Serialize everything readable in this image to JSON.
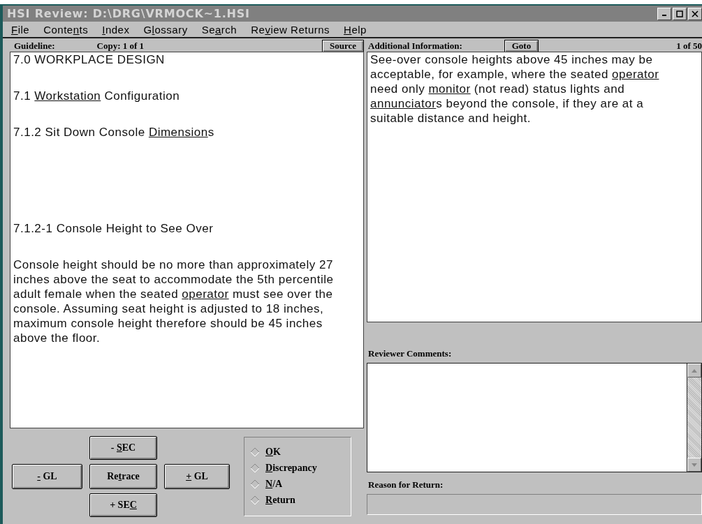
{
  "window": {
    "title": "HSI Review: D:\\DRG\\VRMOCK~1.HSI"
  },
  "menu": [
    {
      "key": "F",
      "post": "ile"
    },
    {
      "pre": "Conte",
      "key": "n",
      "post": "ts"
    },
    {
      "key": "I",
      "post": "ndex"
    },
    {
      "pre": "G",
      "key": "l",
      "post": "ossary"
    },
    {
      "pre": "Se",
      "key": "a",
      "post": "rch"
    },
    {
      "pre": "Re",
      "key": "v",
      "post": "iew Returns"
    },
    {
      "key": "H",
      "post": "elp"
    }
  ],
  "guideline": {
    "label": "Guideline:",
    "copy": "Copy:  1 of 1",
    "source_button": "Source",
    "paragraphs": [
      {
        "kind": "heading",
        "segments": [
          {
            "text": "7.0 WORKPLACE DESIGN",
            "link": false
          }
        ]
      },
      {
        "kind": "heading",
        "segments": [
          {
            "text": "7.1 ",
            "link": false
          },
          {
            "text": "Workstation",
            "link": true
          },
          {
            "text": " Configuration",
            "link": false
          }
        ]
      },
      {
        "kind": "heading",
        "segments": [
          {
            "text": "7.1.2 Sit Down Console ",
            "link": false
          },
          {
            "text": "Dimension",
            "link": true
          },
          {
            "text": "s",
            "link": false
          }
        ]
      },
      {
        "kind": "item",
        "segments": [
          {
            "text": "7.1.2-1 Console Height to See Over",
            "link": false
          }
        ]
      },
      {
        "kind": "body",
        "segments": [
          {
            "text": "Console height should be no more than approximately 27 inches above the seat to accommodate the 5th percentile adult female when the seated ",
            "link": false
          },
          {
            "text": "operator",
            "link": true
          },
          {
            "text": " must see over the console. Assuming seat height is adjusted to 18 inches, maximum console height therefore should be 45 inches above the floor.",
            "link": false
          }
        ]
      }
    ]
  },
  "navigation": {
    "minus_sec": {
      "pre": "- ",
      "key": "S",
      "post": "EC"
    },
    "minus_gl": {
      "key": "-",
      "post": " GL"
    },
    "retrace": {
      "pre": "Re",
      "key": "t",
      "post": "race"
    },
    "plus_gl": {
      "key": "+",
      "post": " GL"
    },
    "plus_sec": {
      "pre": "+ SE",
      "key": "C"
    }
  },
  "status_options": [
    {
      "key": "O",
      "post": "K",
      "selected": false
    },
    {
      "key": "D",
      "post": "iscrepancy",
      "selected": false
    },
    {
      "key": "N",
      "post": "/A",
      "selected": false
    },
    {
      "key": "R",
      "post": "eturn",
      "selected": false
    }
  ],
  "additional_info": {
    "label": "Additional Information:",
    "goto_button": "Goto",
    "position": "1 of 50",
    "segments": [
      {
        "text": "See-over console heights above 45 inches may be acceptable, for example, where the seated ",
        "link": false
      },
      {
        "text": "operator",
        "link": true
      },
      {
        "text": " need only ",
        "link": false
      },
      {
        "text": "monitor",
        "link": true
      },
      {
        "text": " (not read) status lights and ",
        "link": false
      },
      {
        "text": "annunciator",
        "link": true
      },
      {
        "text": "s beyond the console, if they are at a suitable distance and height.",
        "link": false
      }
    ]
  },
  "reviewer_comments": {
    "label": "Reviewer Comments:"
  },
  "reason_for_return": {
    "label": "Reason for Return:",
    "disabled": true
  }
}
